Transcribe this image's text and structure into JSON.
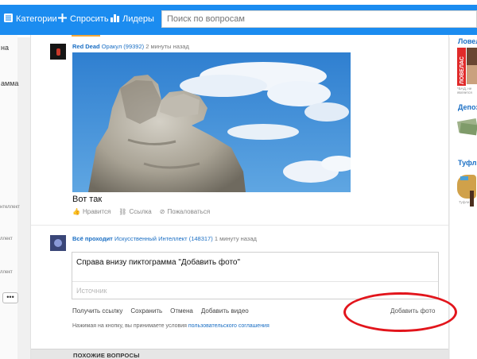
{
  "header": {
    "nav": [
      {
        "label": "Категории",
        "icon": "menu-icon"
      },
      {
        "label": "Спросить",
        "icon": "plus-icon"
      },
      {
        "label": "Лидеры",
        "icon": "bar-chart-icon"
      }
    ],
    "search_placeholder": "Поиск по вопросам"
  },
  "left_sidebar": {
    "items": [
      "на",
      "амма"
    ],
    "small": [
      "нтеллект",
      "ллект",
      "ллект"
    ],
    "more_label": "•••"
  },
  "answer1": {
    "author": "Red Dead",
    "rank": "Оракул (99392)",
    "time": "2 минуты назад",
    "text": "Вот так",
    "actions": {
      "like": "Нравится",
      "link": "Ссылка",
      "report": "Пожаловаться"
    }
  },
  "answer2": {
    "author": "Всё проходит",
    "rank": "Искусственный Интеллект (148317)",
    "time": "1 минуту назад"
  },
  "editor": {
    "text": "Справа внизу пиктограмма \"Добавить фото\"",
    "source_placeholder": "Источник",
    "links": [
      "Получить ссылку",
      "Сохранить",
      "Отмена",
      "Добавить видео"
    ],
    "add_photo": "Добавить фото",
    "terms_prefix": "Нажимая на кнопку, вы принимаете условия ",
    "terms_link": "пользовательского соглашения"
  },
  "similar": {
    "title": "ПОХОЖИЕ ВОПРОСЫ"
  },
  "right_sidebar": {
    "titles": [
      "Ловела",
      "Депоз",
      "Туфл"
    ],
    "ad_text": "ЛОВЕЛАС",
    "ad_note": "*БАД, не является",
    "shoe_label": "Туфли"
  },
  "colors": {
    "brand": "#1b8cf0",
    "link": "#1b6fc4",
    "highlight": "#e2151c",
    "accent": "#f4a83a"
  }
}
